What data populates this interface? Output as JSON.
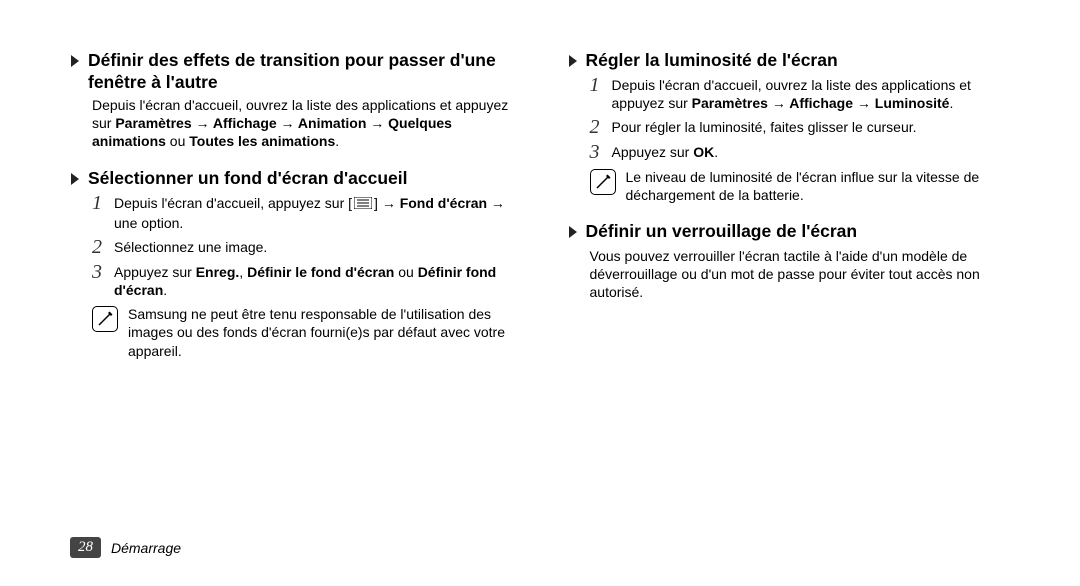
{
  "left": {
    "section1": {
      "title": "Définir des effets de transition pour passer d'une fenêtre à l'autre",
      "intro_a": "Depuis l'écran d'accueil, ouvrez la liste des applications et appuyez sur ",
      "intro_path": "Paramètres → Affichage → Animation → Quelques animations",
      "intro_or": " ou ",
      "intro_path2": "Toutes les animations",
      "intro_dot": "."
    },
    "section2": {
      "title": "Sélectionner un fond d'écran d'accueil",
      "step1_a": "Depuis l'écran d'accueil, appuyez sur [",
      "step1_b": "] ",
      "step1_path": "→ Fond d'écran",
      "step1_c": " → une option.",
      "step2": "Sélectionnez une image.",
      "step3_a": "Appuyez sur ",
      "step3_b": "Enreg.",
      "step3_c": ", ",
      "step3_d": "Définir le fond d'écran",
      "step3_e": " ou ",
      "step3_f": "Définir fond d'écran",
      "step3_g": ".",
      "note": "Samsung ne peut être tenu responsable de l'utilisation des images ou des fonds d'écran fourni(e)s par défaut avec votre appareil."
    }
  },
  "right": {
    "section1": {
      "title": "Régler la luminosité de l'écran",
      "step1_a": "Depuis l'écran d'accueil, ouvrez la liste des applications et appuyez sur ",
      "step1_path": "Paramètres → Affichage → Luminosité",
      "step1_dot": ".",
      "step2": "Pour régler la luminosité, faites glisser le curseur.",
      "step3_a": "Appuyez sur ",
      "step3_b": "OK",
      "step3_c": ".",
      "note": "Le niveau de luminosité de l'écran influe sur la vitesse de déchargement de la batterie."
    },
    "section2": {
      "title": "Définir un verrouillage de l'écran",
      "para": "Vous pouvez verrouiller l'écran tactile à l'aide d'un modèle de déverrouillage ou d'un mot de passe pour éviter tout accès non autorisé."
    }
  },
  "footer": {
    "page": "28",
    "label": "Démarrage"
  }
}
